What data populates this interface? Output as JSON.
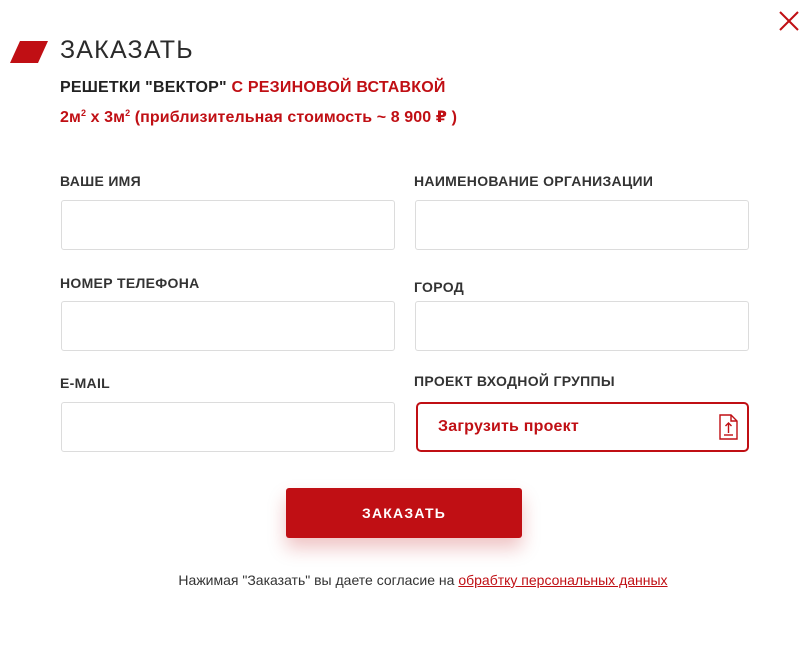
{
  "header": {
    "title": "ЗАКАЗАТЬ",
    "product_name": "РЕШЕТКИ \"ВЕКТОР\"",
    "product_variant": "С РЕЗИНОВОЙ ВСТАВКОЙ",
    "size_prefix": "2м",
    "size_sup1": "2",
    "size_mid": " х 3м",
    "size_sup2": "2",
    "price_text": " (приблизительная стоимость ~ 8 900 ₽ )"
  },
  "form": {
    "name_label": "ВАШЕ ИМЯ",
    "name_value": "",
    "org_label": "НАИМЕНОВАНИЕ ОРГАНИЗАЦИИ",
    "org_value": "",
    "phone_label": "НОМЕР ТЕЛЕФОНА",
    "phone_value": "",
    "city_label": "ГОРОД",
    "city_value": "",
    "email_label": "E-MAIL",
    "email_value": "",
    "project_label": "ПРОЕКТ ВХОДНОЙ ГРУППЫ",
    "upload_label": "Загрузить проект"
  },
  "submit_label": "ЗАКАЗАТЬ",
  "consent": {
    "text": "Нажимая \"Заказать\" вы даете согласие на ",
    "link": "обрабтку персональных данных"
  },
  "colors": {
    "accent": "#c00f14",
    "border": "#dcdcdc"
  },
  "icons": {
    "close": "close-icon",
    "brand": "brand-parallelogram-icon",
    "upload": "file-upload-icon"
  }
}
